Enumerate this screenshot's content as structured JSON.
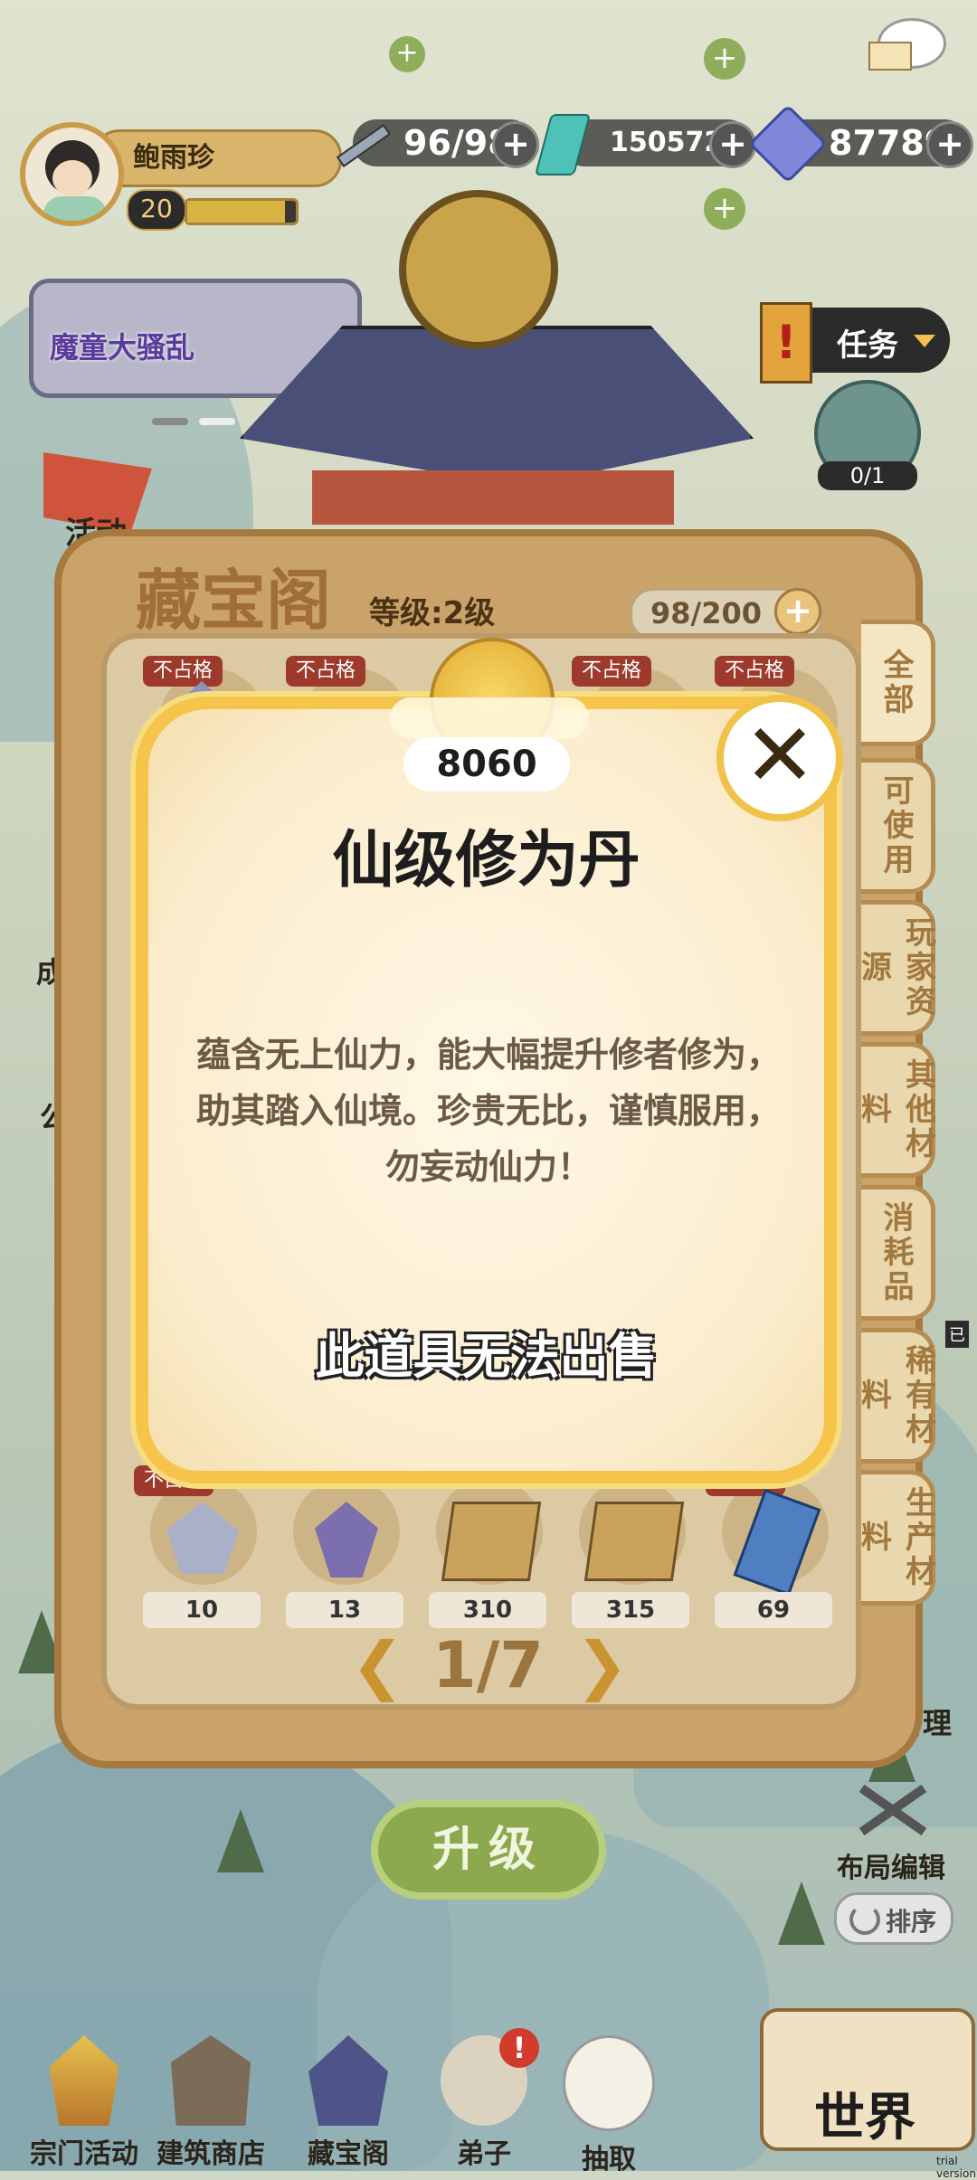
{
  "player": {
    "name": "鲍雨珍",
    "level": "20"
  },
  "resources": {
    "stamina": "96/98",
    "jade": "1505720",
    "crystal": "87789"
  },
  "event_banner": "魔童大骚乱",
  "task_button": "任务",
  "quest_counter": "0/1",
  "side_labels": {
    "activity": "活动",
    "building": "成",
    "public": "公",
    "manage": "管理",
    "lock": "已"
  },
  "storage": {
    "title": "藏宝阁",
    "level": "等级:2级",
    "capacity": "98/200",
    "tabs": [
      "全部",
      "可使用",
      "玩家资源",
      "其他材料",
      "消耗品",
      "稀有材料",
      "生产材料"
    ],
    "tag_label": "不占格",
    "bottom_row": [
      {
        "icon": "crystal-icon",
        "count": "10"
      },
      {
        "icon": "purple-crystal-icon",
        "count": "13"
      },
      {
        "icon": "book-icon",
        "count": "310"
      },
      {
        "icon": "book-icon",
        "count": "315"
      },
      {
        "icon": "blue-scroll-icon",
        "count": "69"
      }
    ],
    "pagination": {
      "prev": "❮",
      "page": "1/7",
      "next": "❯"
    },
    "upgrade_button": "升级"
  },
  "item_popup": {
    "quantity": "8060",
    "name": "仙级修为丹",
    "description": "蕴含无上仙力，能大幅提升修者修为，助其踏入仙境。珍贵无比，谨慎服用，勿妄动仙力！",
    "sell_note": "此道具无法出售",
    "close": "✕"
  },
  "layout_tools": {
    "edit": "布局编辑",
    "sort": "排序"
  },
  "bottom_nav": [
    {
      "label": "宗门活动",
      "icon": "pagoda-icon"
    },
    {
      "label": "建筑商店",
      "icon": "shop-icon"
    },
    {
      "label": "藏宝阁",
      "icon": "treasure-pavilion-icon"
    },
    {
      "label": "弟子",
      "icon": "disciple-icon"
    },
    {
      "label": "抽取",
      "icon": "bird-icon"
    }
  ],
  "world_button": "世界",
  "watermark": "trial version",
  "colors": {
    "gold": "#f6c44a",
    "panel": "#c9a36a",
    "tag_red": "#9d3a2b",
    "upgrade_green": "#8da94f"
  }
}
